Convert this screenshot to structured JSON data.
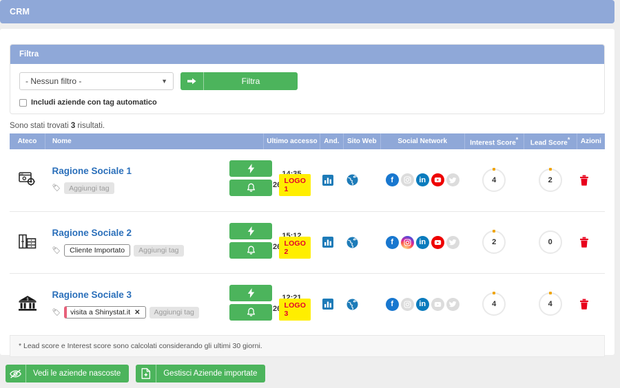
{
  "header": {
    "title": "CRM"
  },
  "filter": {
    "panel_title": "Filtra",
    "select_value": "- Nessun filtro -",
    "select_options": [
      "- Nessun filtro -"
    ],
    "submit_label": "Filtra",
    "checkbox_label": "Includi aziende con tag automatico",
    "checkbox_checked": false
  },
  "results": {
    "prefix": "Sono stati trovati ",
    "count": "3",
    "suffix": " risultati."
  },
  "table": {
    "columns": {
      "ateco": "Ateco",
      "nome": "Nome",
      "ultimo_accesso": "Ultimo accesso",
      "and": "And.",
      "sito_web": "Sito Web",
      "social_network": "Social Network",
      "interest_score": "Interest Score",
      "lead_score": "Lead Score",
      "azioni": "Azioni",
      "star": "*"
    },
    "rows": [
      {
        "ateco_icon": "window-gear-icon",
        "name": "Ragione Sociale 1",
        "tags": [],
        "add_tag_label": "Aggiungi tag",
        "logo_label": "LOGO 1",
        "time": "14:35",
        "date": "26/10/2021",
        "social": {
          "facebook": true,
          "instagram": false,
          "linkedin": true,
          "youtube": true,
          "twitter": false
        },
        "interest_score": "4",
        "interest_mark": true,
        "lead_score": "2",
        "lead_mark": true
      },
      {
        "ateco_icon": "furniture-icon",
        "name": "Ragione Sociale 2",
        "tags": [
          {
            "label": "Cliente Importato",
            "removable": false,
            "bar": false
          }
        ],
        "add_tag_label": "Aggiungi tag",
        "logo_label": "LOGO 2",
        "time": "15:12",
        "date": "26/10/2021",
        "social": {
          "facebook": true,
          "instagram": true,
          "linkedin": true,
          "youtube": true,
          "twitter": false
        },
        "interest_score": "2",
        "interest_mark": true,
        "lead_score": "0",
        "lead_mark": false
      },
      {
        "ateco_icon": "bank-building-icon",
        "name": "Ragione Sociale 3",
        "tags": [
          {
            "label": "visita a Shinystat.it",
            "removable": true,
            "bar": true,
            "remove_glyph": "✕"
          }
        ],
        "add_tag_label": "Aggiungi tag",
        "logo_label": "LOGO 3",
        "time": "12:21",
        "date": "26/10/2021",
        "social": {
          "facebook": true,
          "instagram": false,
          "linkedin": true,
          "youtube": false,
          "twitter": false
        },
        "interest_score": "4",
        "interest_mark": true,
        "lead_score": "4",
        "lead_mark": true
      }
    ]
  },
  "footnote": "* Lead score e Interest score sono calcolati considerando gli ultimi 30 giorni.",
  "bottom": {
    "hidden_companies_label": "Vedi le aziende nascoste",
    "manage_imported_label": "Gestisci Aziende importate"
  },
  "colors": {
    "header_blue": "#8fa8d8",
    "green": "#4cb45c",
    "link_blue": "#2a6fba",
    "logo_yellow": "#ffee00",
    "logo_red": "#e4002b",
    "trash_red": "#e8001c",
    "ring_mark": "#f0a500"
  }
}
